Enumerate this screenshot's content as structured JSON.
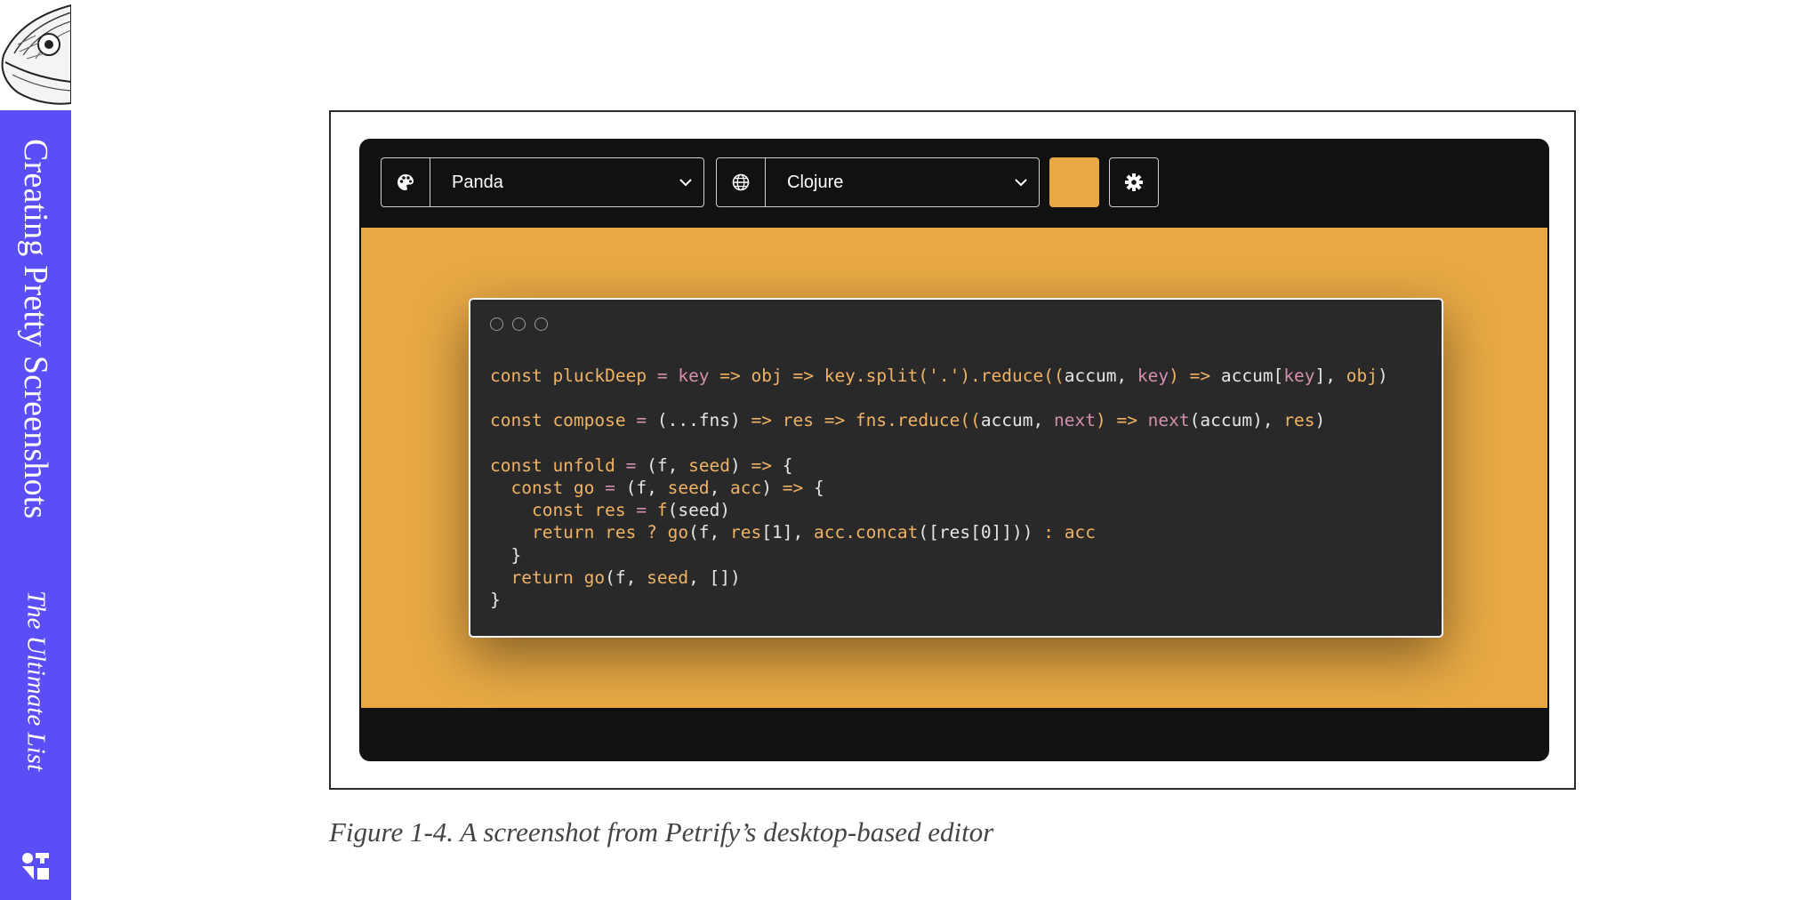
{
  "book": {
    "chapter_title": "Creating Pretty Screenshots",
    "subtitle": "The Ultimate List"
  },
  "editor": {
    "theme_select": {
      "icon": "palette-icon",
      "value": "Panda"
    },
    "language_select": {
      "icon": "globe-icon",
      "value": "Clojure"
    },
    "background_color": "#e8a944",
    "settings_icon": "gear-icon",
    "code_lines": [
      [
        [
          "k",
          "const pluckDeep "
        ],
        [
          "p",
          "= "
        ],
        [
          "p",
          "key"
        ],
        [
          "k",
          " => obj => key.split('.').reduce(("
        ],
        [
          "w",
          "accum, "
        ],
        [
          "p",
          "key"
        ],
        [
          "k",
          ") => "
        ],
        [
          "w",
          "accum["
        ],
        [
          "p",
          "key"
        ],
        [
          "w",
          "], "
        ],
        [
          "k",
          "obj"
        ],
        [
          "w",
          ")"
        ]
      ],
      [],
      [
        [
          "k",
          "const compose "
        ],
        [
          "p",
          "= "
        ],
        [
          "w",
          "(...fns) "
        ],
        [
          "k",
          "=> res => fns.reduce(("
        ],
        [
          "w",
          "accum, "
        ],
        [
          "p",
          "next"
        ],
        [
          "k",
          ") => "
        ],
        [
          "p",
          "next"
        ],
        [
          "w",
          "(accum), "
        ],
        [
          "k",
          "res"
        ],
        [
          "w",
          ")"
        ]
      ],
      [],
      [
        [
          "k",
          "const unfold "
        ],
        [
          "p",
          "= "
        ],
        [
          "w",
          "(f, "
        ],
        [
          "k",
          "seed"
        ],
        [
          "w",
          ") "
        ],
        [
          "k",
          "=> "
        ],
        [
          "w",
          "{"
        ]
      ],
      [
        [
          "k",
          "  const go "
        ],
        [
          "p",
          "= "
        ],
        [
          "w",
          "(f, "
        ],
        [
          "k",
          "seed"
        ],
        [
          "w",
          ", "
        ],
        [
          "k",
          "acc"
        ],
        [
          "w",
          ") "
        ],
        [
          "k",
          "=> "
        ],
        [
          "w",
          "{"
        ]
      ],
      [
        [
          "k",
          "    const res "
        ],
        [
          "p",
          "= "
        ],
        [
          "k",
          "f"
        ],
        [
          "w",
          "(seed)"
        ]
      ],
      [
        [
          "k",
          "    return res ? go"
        ],
        [
          "w",
          "(f, "
        ],
        [
          "k",
          "res"
        ],
        [
          "w",
          "[1], "
        ],
        [
          "k",
          "acc.concat"
        ],
        [
          "w",
          "([res[0]])) "
        ],
        [
          "k",
          ": acc"
        ]
      ],
      [
        [
          "w",
          "  }"
        ]
      ],
      [
        [
          "k",
          "  return go"
        ],
        [
          "w",
          "(f, "
        ],
        [
          "k",
          "seed"
        ],
        [
          "w",
          ", [])"
        ]
      ],
      [
        [
          "w",
          "}"
        ]
      ]
    ]
  },
  "caption": "Figure 1-4. A screenshot from Petrify’s desktop-based editor"
}
